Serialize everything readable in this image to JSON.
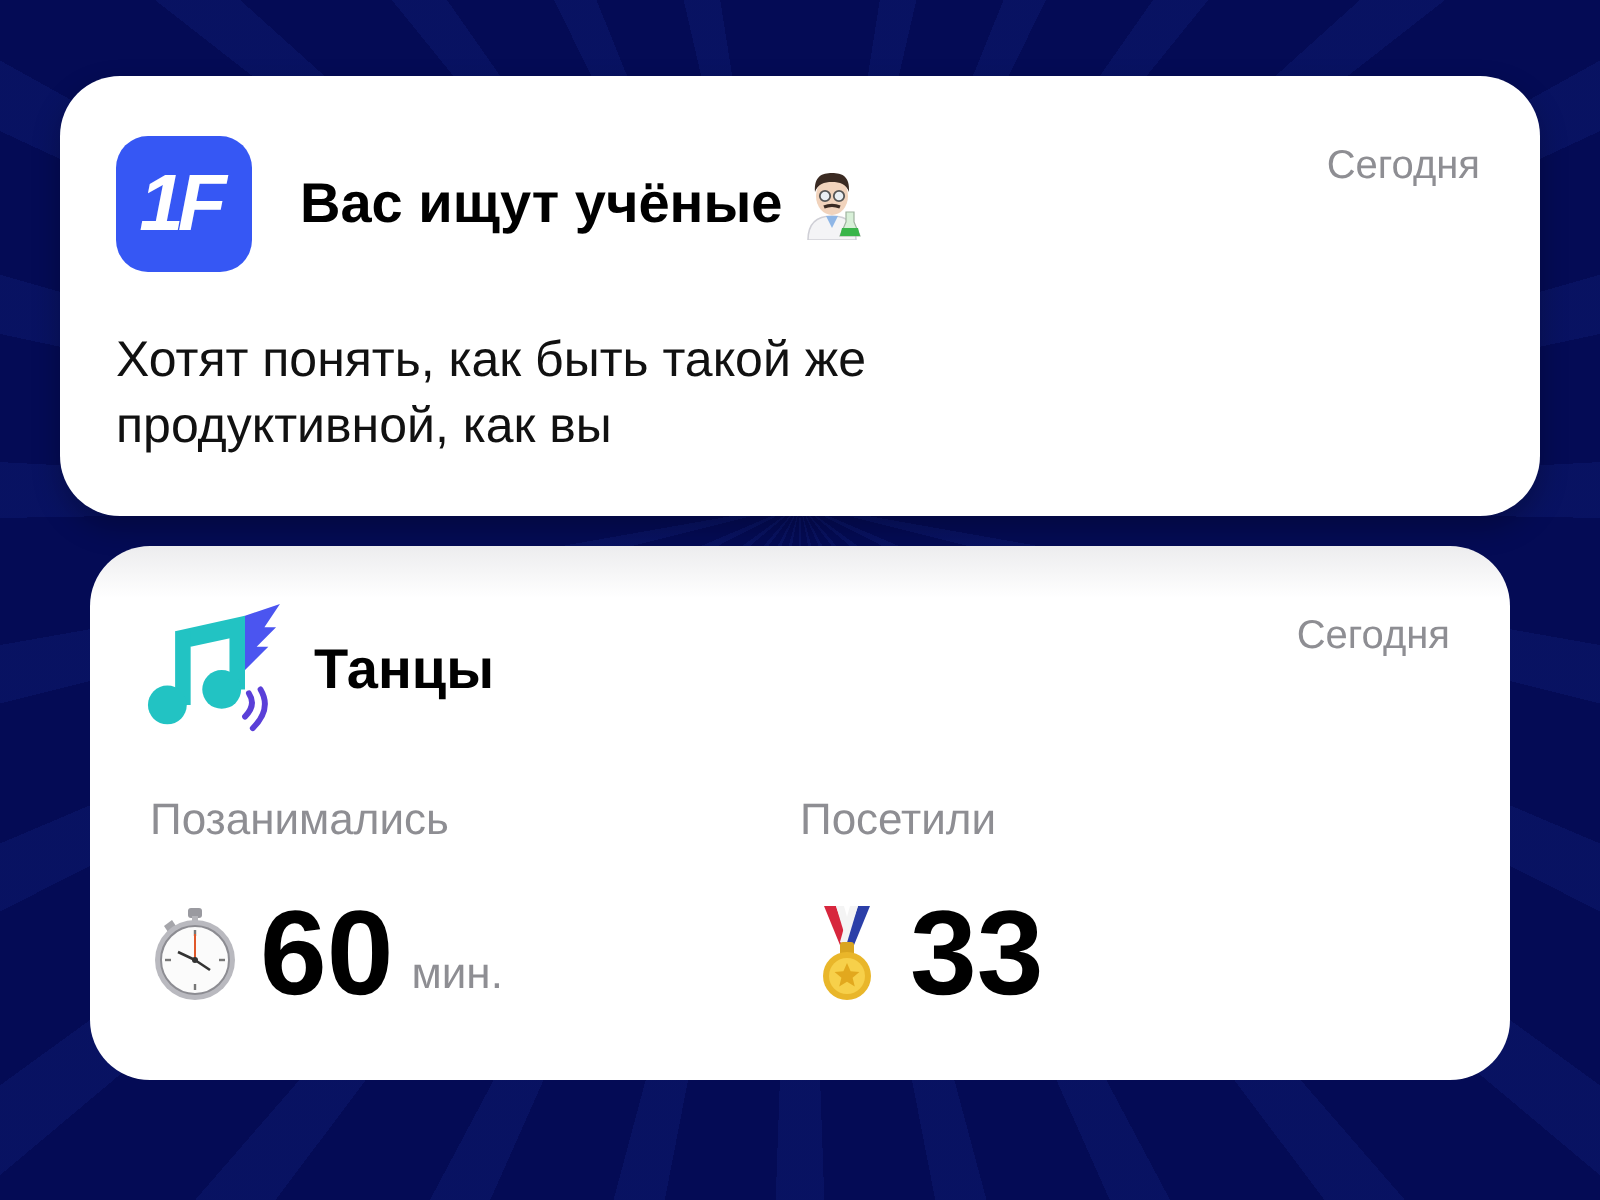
{
  "notifications": [
    {
      "kind": "message",
      "app_logo": "1F",
      "title": "Вас ищут учёные",
      "time": "Сегодня",
      "body": "Хотят понять, как быть такой же продуктивной, как вы"
    },
    {
      "kind": "stats",
      "title": "Танцы",
      "time": "Сегодня",
      "stats": [
        {
          "kind": "duration",
          "label": "Позанимались",
          "value": "60",
          "unit": "мин."
        },
        {
          "kind": "visits",
          "label": "Посетили",
          "value": "33"
        }
      ]
    }
  ]
}
